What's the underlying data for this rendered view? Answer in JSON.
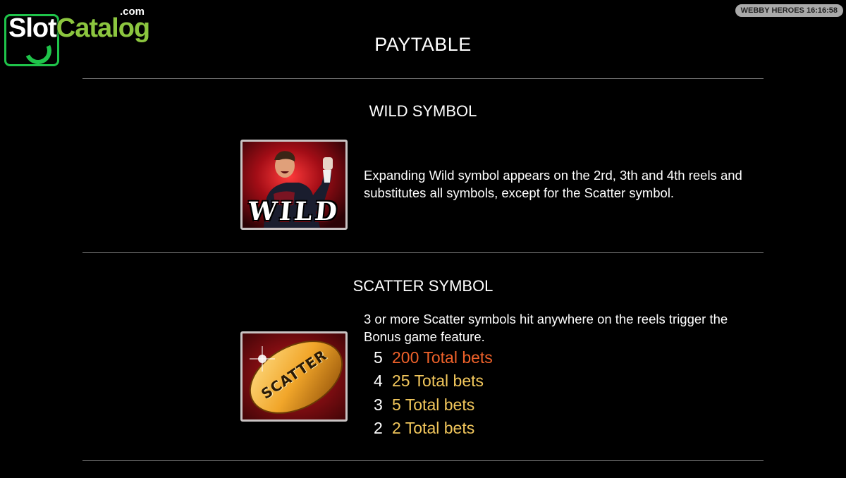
{
  "watermark": {
    "slot": "Slot",
    "catalog": "Catalog",
    "com": ".com"
  },
  "status_badge": "WEBBY HEROES 16:16:58",
  "title": "PAYTABLE",
  "wild": {
    "heading": "WILD SYMBOL",
    "image_text": "WILD",
    "description": "Expanding Wild symbol appears on the 2rd, 3th and 4th reels and substitutes all symbols, except for the Scatter symbol."
  },
  "scatter": {
    "heading": "SCATTER SYMBOL",
    "image_text": "SCATTER",
    "description": "3 or more Scatter symbols hit anywhere on the reels trigger the Bonus game feature.",
    "payouts": [
      {
        "count": "5",
        "value": "200 Total bets"
      },
      {
        "count": "4",
        "value": "25 Total bets"
      },
      {
        "count": "3",
        "value": "5 Total bets"
      },
      {
        "count": "2",
        "value": "2 Total bets"
      }
    ]
  },
  "colors": {
    "background": "#000000",
    "divider": "#777777",
    "payout_highlight": "#f0622a",
    "payout_value": "#f2c75c",
    "logo_green": "#1fc44a",
    "logo_catalog": "#8cc63f"
  }
}
